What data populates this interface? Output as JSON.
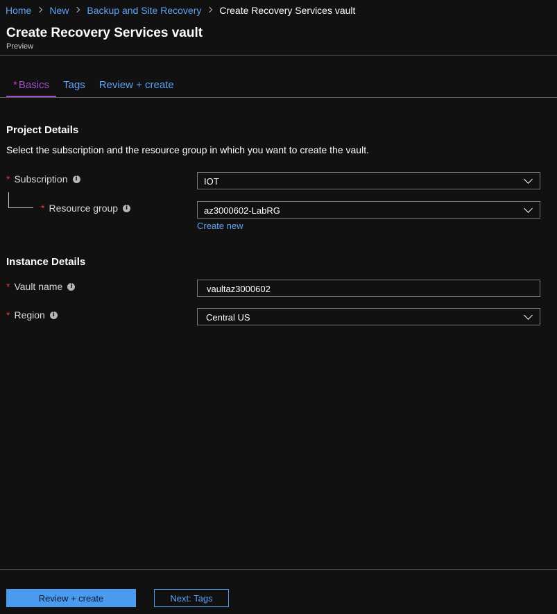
{
  "breadcrumb": {
    "items": [
      "Home",
      "New",
      "Backup and Site Recovery"
    ],
    "current": "Create Recovery Services vault"
  },
  "header": {
    "title": "Create Recovery Services vault",
    "subtitle": "Preview"
  },
  "tabs": [
    {
      "label": "Basics",
      "required": "*",
      "active": true
    },
    {
      "label": "Tags",
      "active": false
    },
    {
      "label": "Review + create",
      "active": false
    }
  ],
  "project": {
    "title": "Project Details",
    "description": "Select the subscription and the resource group in which you want to create the vault.",
    "subscription": {
      "label": "Subscription",
      "value": "IOT"
    },
    "resource_group": {
      "label": "Resource group",
      "value": "az3000602-LabRG",
      "create_new": "Create new"
    }
  },
  "instance": {
    "title": "Instance Details",
    "vault_name": {
      "label": "Vault name",
      "value": "vaultaz3000602"
    },
    "region": {
      "label": "Region",
      "value": "Central US"
    }
  },
  "footer": {
    "primary": "Review + create",
    "secondary": "Next: Tags"
  },
  "colors": {
    "background": "#111111",
    "link": "#5ea3f5",
    "active_tab": "#9b4fc8",
    "required_star": "#e03a3a",
    "primary_button": "#4a9bf0"
  },
  "symbols": {
    "required": "*",
    "info": "i"
  }
}
